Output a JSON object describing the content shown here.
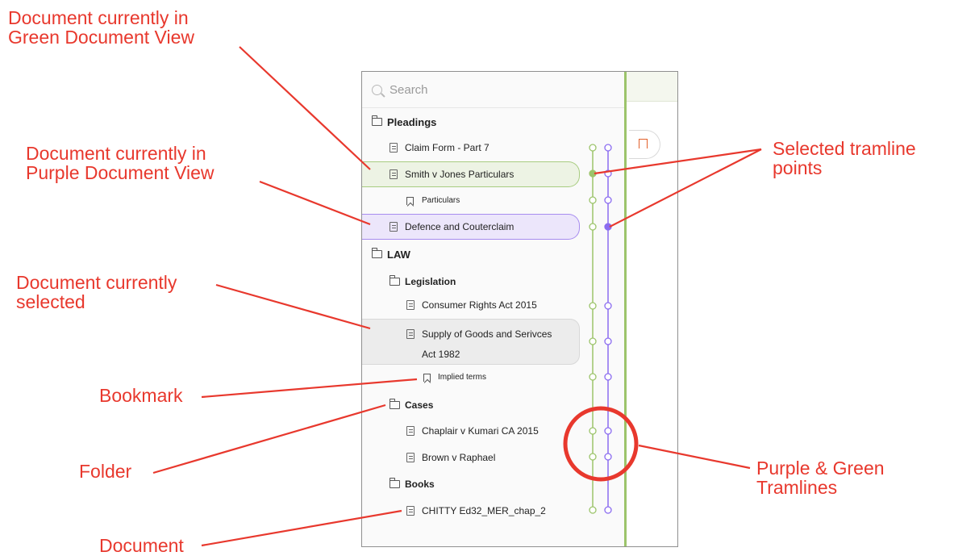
{
  "search": {
    "placeholder": "Search"
  },
  "tree": {
    "pleadings": "Pleadings",
    "claim_form": "Claim Form - Part 7",
    "smith": "Smith v Jones Particulars",
    "particulars": "Particulars",
    "defence": "Defence and Couterclaim",
    "law": "LAW",
    "legislation": "Legislation",
    "consumer": "Consumer Rights Act 2015",
    "supply_line1": "Supply of Goods and Serivces",
    "supply_line2": "Act 1982",
    "implied": "Implied terms",
    "cases": "Cases",
    "chaplair": "Chaplair v Kumari CA 2015",
    "brown": "Brown v Raphael",
    "books": "Books",
    "chitty": "CHITTY Ed32_MER_chap_2"
  },
  "callouts": {
    "green_view": [
      "Document currently in",
      "Green Document View"
    ],
    "purple_view": [
      "Document currently in",
      "Purple Document View"
    ],
    "selected": [
      "Document currently",
      "selected"
    ],
    "bookmark": "Bookmark",
    "folder": "Folder",
    "document": "Document",
    "tramline_points": [
      "Selected tramline",
      "points"
    ],
    "tramlines": [
      "Purple & Green",
      "Tramlines"
    ]
  },
  "colors": {
    "green": "#9cc46b",
    "purple": "#8b6cf0",
    "annotation_red": "#e8382d"
  }
}
